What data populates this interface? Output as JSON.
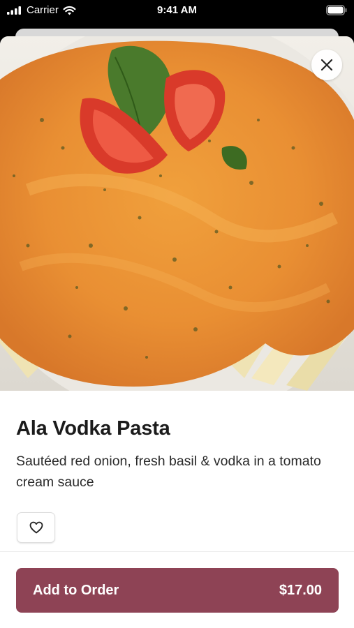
{
  "status_bar": {
    "carrier": "Carrier",
    "time": "9:41 AM",
    "icons": [
      "signal-icon",
      "wifi-icon",
      "battery-icon"
    ]
  },
  "item": {
    "image": "dish-photo-ala-vodka-pasta",
    "title": "Ala Vodka Pasta",
    "description": "Sautéed red onion, fresh basil & vodka in a tomato cream sauce"
  },
  "buttons": {
    "close_icon": "close-icon",
    "favorite_icon": "heart-icon",
    "add_to_order_label": "Add to Order",
    "price": "$17.00"
  },
  "colors": {
    "accent": "#8e4355",
    "sheet_background": "#ffffff",
    "status_bar_background": "#000000"
  }
}
